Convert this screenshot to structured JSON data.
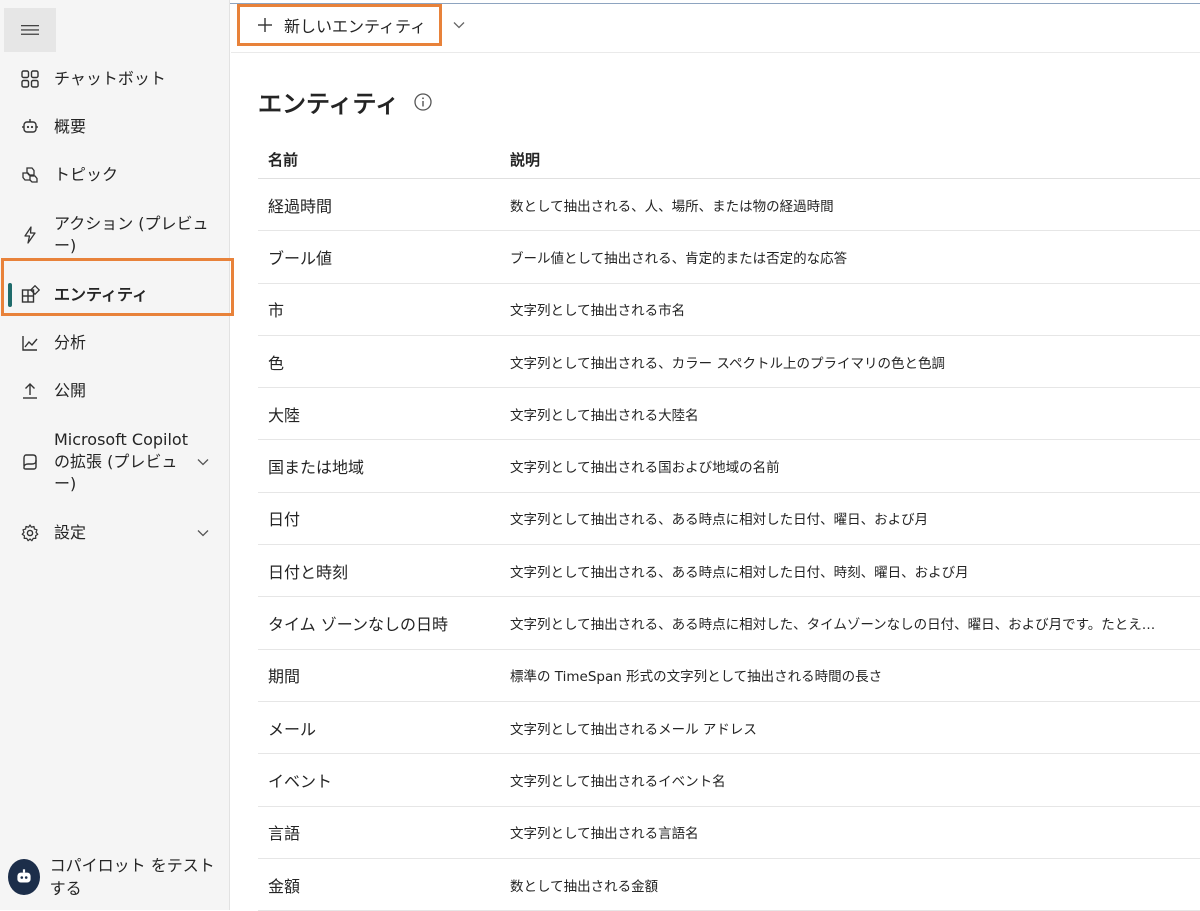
{
  "toolbar": {
    "new_entity_label": "新しいエンティティ"
  },
  "page": {
    "title": "エンティティ"
  },
  "sidebar": {
    "items": [
      {
        "label": "チャットボット",
        "icon": "grid-icon"
      },
      {
        "label": "概要",
        "icon": "bot-icon"
      },
      {
        "label": "トピック",
        "icon": "cubes-icon"
      },
      {
        "label": "アクション (プレビュー)",
        "icon": "lightning-icon"
      },
      {
        "label": "エンティティ",
        "icon": "entity-icon",
        "active": true
      },
      {
        "label": "分析",
        "icon": "chart-icon"
      },
      {
        "label": "公開",
        "icon": "upload-icon"
      },
      {
        "label": "Microsoft Copilot の拡張 (プレビュー)",
        "icon": "copilot-icon"
      },
      {
        "label": "設定",
        "icon": "gear-icon"
      }
    ],
    "test_label": "コパイロット をテストする"
  },
  "table": {
    "headers": {
      "name": "名前",
      "description": "説明"
    },
    "rows": [
      {
        "name": "経過時間",
        "description": "数として抽出される、人、場所、または物の経過時間"
      },
      {
        "name": "ブール値",
        "description": "ブール値として抽出される、肯定的または否定的な応答"
      },
      {
        "name": "市",
        "description": "文字列として抽出される市名"
      },
      {
        "name": "色",
        "description": "文字列として抽出される、カラー スペクトル上のプライマリの色と色調"
      },
      {
        "name": "大陸",
        "description": "文字列として抽出される大陸名"
      },
      {
        "name": "国または地域",
        "description": "文字列として抽出される国および地域の名前"
      },
      {
        "name": "日付",
        "description": "文字列として抽出される、ある時点に相対した日付、曜日、および月"
      },
      {
        "name": "日付と時刻",
        "description": "文字列として抽出される、ある時点に相対した日付、時刻、曜日、および月"
      },
      {
        "name": "タイム ゾーンなしの日時",
        "description": "文字列として抽出される、ある時点に相対した、タイムゾーンなしの日付、曜日、および月です。たとえ…"
      },
      {
        "name": "期間",
        "description": "標準の TimeSpan 形式の文字列として抽出される時間の長さ"
      },
      {
        "name": "メール",
        "description": "文字列として抽出されるメール アドレス"
      },
      {
        "name": "イベント",
        "description": "文字列として抽出されるイベント名"
      },
      {
        "name": "言語",
        "description": "文字列として抽出される言語名"
      },
      {
        "name": "金額",
        "description": "数として抽出される金額"
      }
    ]
  },
  "colors": {
    "highlight": "#e8823a",
    "active_indicator": "#1f6b6b",
    "avatar_bg": "#1c2e4a"
  }
}
